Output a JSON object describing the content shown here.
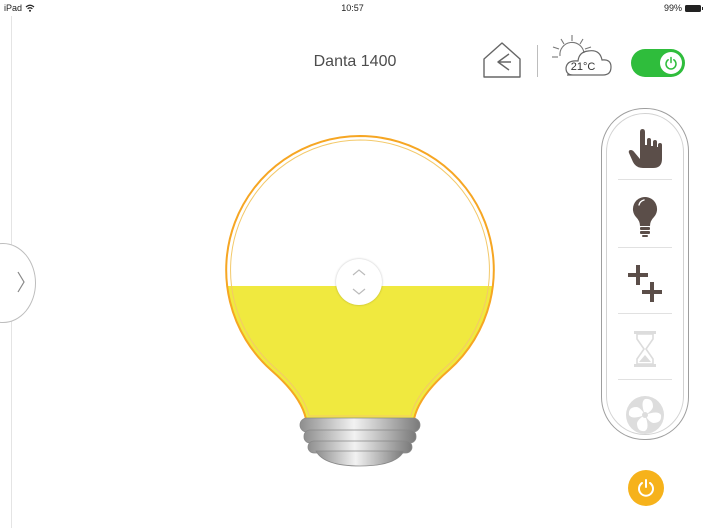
{
  "status_bar": {
    "device": "iPad",
    "time": "10:57",
    "battery": "99%"
  },
  "header": {
    "title": "Danta 1400",
    "temperature": "21°C",
    "power_on": true
  },
  "bulb": {
    "fill_level": 0.47,
    "fill_color": "#f0e93f",
    "outline_color": "#f6a623"
  },
  "modes": [
    {
      "name": "manual",
      "icon": "hand-pointer-icon",
      "active": true
    },
    {
      "name": "light",
      "icon": "light-bulb-icon",
      "active": true
    },
    {
      "name": "boost",
      "icon": "plus-plus-icon",
      "active": true
    },
    {
      "name": "timer",
      "icon": "hourglass-icon",
      "active": false
    },
    {
      "name": "fan",
      "icon": "fan-icon",
      "active": false
    }
  ],
  "colors": {
    "toggle_on": "#2fbd3c",
    "power_button": "#f6b21b",
    "icon_dark": "#5b4e49",
    "icon_disabled": "#dcdcdc"
  }
}
